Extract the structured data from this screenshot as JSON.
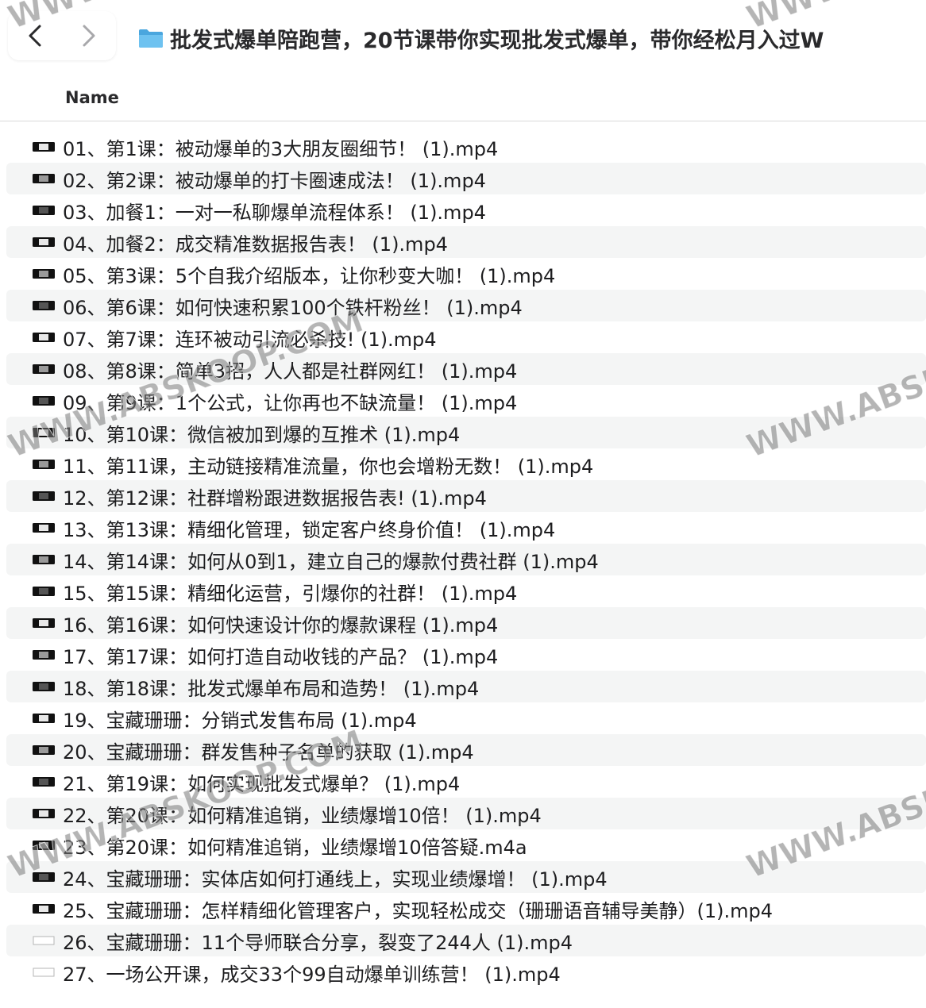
{
  "toolbar": {
    "back_icon": "chevron-left-icon",
    "forward_icon": "chevron-right-icon",
    "folder_icon": "folder-icon",
    "title": "批发式爆单陪跑营，20节课带你实现批发式爆单，带你经松月入过W"
  },
  "header": {
    "name_label": "Name"
  },
  "files": [
    {
      "name": "01、第1课：被动爆单的3大朋友圈细节！ (1).mp4",
      "thumb": "video-thumbnail-icon"
    },
    {
      "name": "02、第2课：被动爆单的打卡圈速成法！ (1).mp4",
      "thumb": "video-thumbnail-icon"
    },
    {
      "name": "03、加餐1：一对一私聊爆单流程体系！ (1).mp4",
      "thumb": "video-thumbnail-icon"
    },
    {
      "name": "04、加餐2：成交精准数据报告表！ (1).mp4",
      "thumb": "video-thumbnail-icon"
    },
    {
      "name": "05、第3课：5个自我介绍版本，让你秒变大咖！ (1).mp4",
      "thumb": "video-thumbnail-icon"
    },
    {
      "name": "06、第6课：如何快速积累100个铁杆粉丝！ (1).mp4",
      "thumb": "video-thumbnail-icon"
    },
    {
      "name": "07、第7课：连环被动引流必杀技! (1).mp4",
      "thumb": "video-thumbnail-icon"
    },
    {
      "name": "08、第8课：简单3招，人人都是社群网红！ (1).mp4",
      "thumb": "video-thumbnail-icon"
    },
    {
      "name": "09、第9课：1个公式，让你再也不缺流量！ (1).mp4",
      "thumb": "video-thumbnail-icon"
    },
    {
      "name": "10、第10课：微信被加到爆的互推术 (1).mp4",
      "thumb": "video-thumbnail-icon"
    },
    {
      "name": "11、第11课，主动链接精准流量，你也会增粉无数！ (1).mp4",
      "thumb": "video-thumbnail-icon"
    },
    {
      "name": "12、第12课：社群增粉跟进数据报告表! (1).mp4",
      "thumb": "video-thumbnail-icon"
    },
    {
      "name": "13、第13课：精细化管理，锁定客户终身价值！ (1).mp4",
      "thumb": "video-thumbnail-icon"
    },
    {
      "name": "14、第14课：如何从0到1，建立自己的爆款付费社群 (1).mp4",
      "thumb": "video-thumbnail-icon"
    },
    {
      "name": "15、第15课：精细化运营，引爆你的社群！ (1).mp4",
      "thumb": "video-thumbnail-icon"
    },
    {
      "name": "16、第16课：如何快速设计你的爆款课程 (1).mp4",
      "thumb": "video-thumbnail-icon"
    },
    {
      "name": "17、第17课：如何打造自动收钱的产品？ (1).mp4",
      "thumb": "video-thumbnail-icon"
    },
    {
      "name": "18、第18课：批发式爆单布局和造势！ (1).mp4",
      "thumb": "video-thumbnail-icon"
    },
    {
      "name": "19、宝藏珊珊：分销式发售布局 (1).mp4",
      "thumb": "video-thumbnail-icon"
    },
    {
      "name": "20、宝藏珊珊：群发售种子名单的获取 (1).mp4",
      "thumb": "video-thumbnail-icon"
    },
    {
      "name": "21、第19课：如何实现批发式爆单？ (1).mp4",
      "thumb": "video-thumbnail-icon"
    },
    {
      "name": "22、第20课：如何精准追销，业绩爆增10倍！ (1).mp4",
      "thumb": "video-thumbnail-icon"
    },
    {
      "name": "23、第20课：如何精准追销，业绩爆增10倍答疑.m4a",
      "thumb": "audio-file-icon"
    },
    {
      "name": "24、宝藏珊珊：实体店如何打通线上，实现业绩爆增！ (1).mp4",
      "thumb": "video-thumbnail-icon"
    },
    {
      "name": "25、宝藏珊珊：怎样精细化管理客户，实现轻松成交（珊珊语音辅导美静）(1).mp4",
      "thumb": "video-thumbnail-icon"
    },
    {
      "name": "26、宝藏珊珊：11个导师联合分享，裂变了244人 (1).mp4",
      "thumb": "blank-thumbnail-icon"
    },
    {
      "name": "27、一场公开课，成交33个99自动爆单训练营！ (1).mp4",
      "thumb": "blank-thumbnail-icon"
    }
  ],
  "watermarks": [
    {
      "text": "WWW.ABSKOOP.COM"
    },
    {
      "text": "WWW.ABSKOOP.COM"
    },
    {
      "text": "WWW.ABSKOOP.COM"
    },
    {
      "text": "WWW.ABSKOOP.COM"
    },
    {
      "text": "WWW.ABSKOOP.COM"
    },
    {
      "text": "WWW.ABSKOOP.COM"
    }
  ],
  "colors": {
    "folder": "#5ab3e8",
    "chevron_active": "#2a2a2c",
    "chevron_inactive": "#a8a8ab",
    "row_alt": "#f4f5f5",
    "text": "#1d1d1f"
  }
}
